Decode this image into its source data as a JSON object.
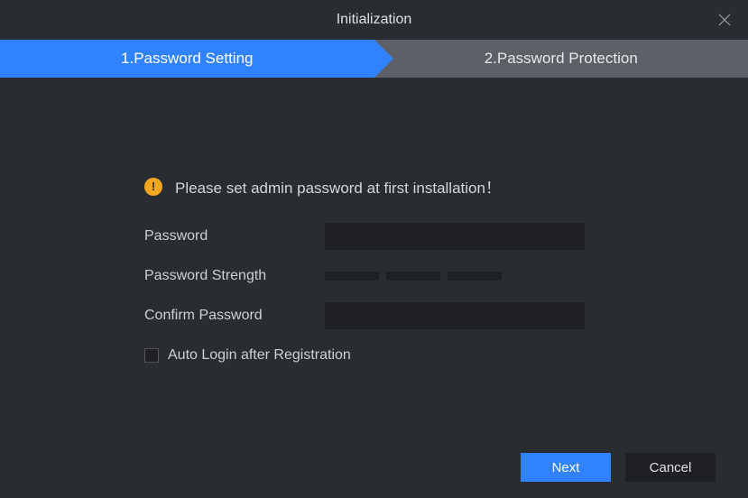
{
  "window": {
    "title": "Initialization"
  },
  "steps": {
    "step1": "1.Password Setting",
    "step2": "2.Password Protection"
  },
  "form": {
    "hint": "Please set admin password at first installation！",
    "password_label": "Password",
    "password_value": "",
    "strength_label": "Password Strength",
    "confirm_label": "Confirm Password",
    "confirm_value": "",
    "autologin_label": "Auto Login after Registration",
    "autologin_checked": false
  },
  "buttons": {
    "next": "Next",
    "cancel": "Cancel"
  },
  "colors": {
    "accent": "#3082ff",
    "warn": "#f5a623",
    "bg": "#292c31",
    "input_bg": "#1e2024",
    "step_inactive": "#5d6066"
  }
}
